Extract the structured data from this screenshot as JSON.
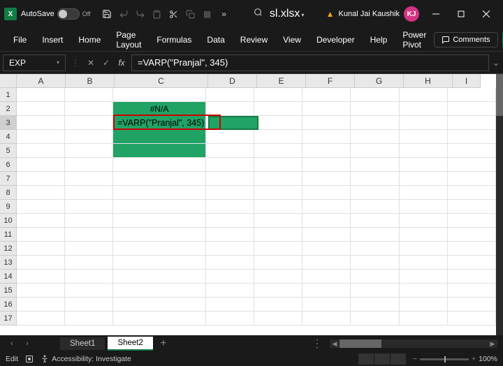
{
  "titlebar": {
    "autosave_label": "AutoSave",
    "autosave_state": "Off",
    "filename": "sl.xlsx",
    "user_name": "Kunal Jai Kaushik",
    "user_initials": "KJ"
  },
  "ribbon": {
    "tabs": [
      "File",
      "Insert",
      "Home",
      "Page Layout",
      "Formulas",
      "Data",
      "Review",
      "View",
      "Developer",
      "Help",
      "Power Pivot"
    ],
    "comments": "Comments"
  },
  "formula_bar": {
    "name_box": "EXP",
    "formula": "=VARP(\"Pranjal\", 345)"
  },
  "grid": {
    "columns": [
      "A",
      "B",
      "C",
      "D",
      "E",
      "F",
      "G",
      "H",
      "I"
    ],
    "rows": [
      "1",
      "2",
      "3",
      "4",
      "5",
      "6",
      "7",
      "8",
      "9",
      "10",
      "11",
      "12",
      "13",
      "14",
      "15",
      "16",
      "17"
    ],
    "cells": {
      "C2": "#N/A",
      "C3_formula": "=VARP(\"Pranjal\", 345)"
    }
  },
  "sheets": {
    "tabs": [
      "Sheet1",
      "Sheet2"
    ],
    "active": "Sheet2"
  },
  "status": {
    "mode": "Edit",
    "accessibility": "Accessibility: Investigate",
    "zoom": "100%"
  }
}
